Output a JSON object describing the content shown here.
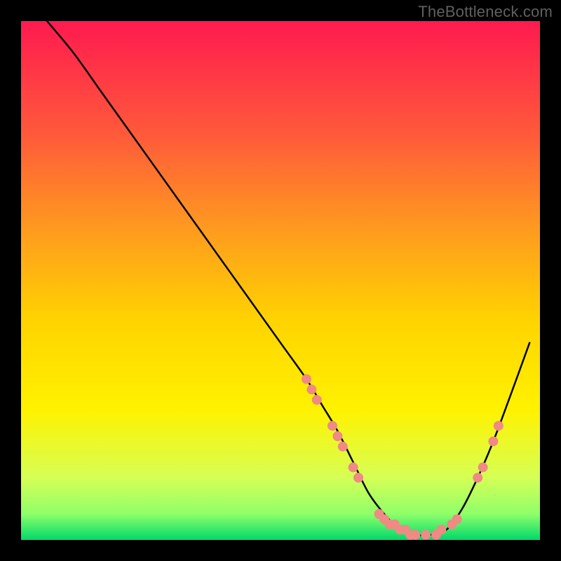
{
  "watermark": "TheBottleneck.com",
  "chart_data": {
    "type": "line",
    "title": "",
    "xlabel": "",
    "ylabel": "",
    "xlim": [
      0,
      100
    ],
    "ylim": [
      0,
      100
    ],
    "grid": false,
    "legend": false,
    "background_gradient": {
      "top": "#ff1a4f",
      "upper_mid": "#ff8a1f",
      "mid": "#ffe500",
      "lower": "#d6ff55",
      "bottom": "#00d96b"
    },
    "series": [
      {
        "name": "bottleneck-curve",
        "color": "#000000",
        "x": [
          5,
          10,
          15,
          20,
          25,
          30,
          35,
          40,
          45,
          50,
          55,
          58,
          61,
          64,
          67,
          70,
          73,
          76,
          79,
          82,
          85,
          88,
          91,
          94,
          98
        ],
        "y": [
          100,
          94,
          87,
          80,
          73,
          66,
          59,
          52,
          45,
          38,
          31,
          26,
          21,
          15,
          9,
          5,
          2,
          1,
          1,
          2,
          6,
          12,
          19,
          27,
          38
        ]
      }
    ],
    "markers": [
      {
        "name": "marker-cluster-left",
        "color": "#ef8a84",
        "points": [
          {
            "x": 55,
            "y": 31
          },
          {
            "x": 56,
            "y": 29
          },
          {
            "x": 57,
            "y": 27
          },
          {
            "x": 60,
            "y": 22
          },
          {
            "x": 61,
            "y": 20
          },
          {
            "x": 62,
            "y": 18
          },
          {
            "x": 64,
            "y": 14
          },
          {
            "x": 65,
            "y": 12
          }
        ]
      },
      {
        "name": "marker-cluster-bottom",
        "color": "#ef8a84",
        "points": [
          {
            "x": 69,
            "y": 5
          },
          {
            "x": 70,
            "y": 4
          },
          {
            "x": 71,
            "y": 3
          },
          {
            "x": 72,
            "y": 3
          },
          {
            "x": 73,
            "y": 2
          },
          {
            "x": 74,
            "y": 2
          },
          {
            "x": 75,
            "y": 1
          },
          {
            "x": 76,
            "y": 1
          },
          {
            "x": 78,
            "y": 1
          },
          {
            "x": 80,
            "y": 1
          },
          {
            "x": 81,
            "y": 2
          },
          {
            "x": 83,
            "y": 3
          },
          {
            "x": 84,
            "y": 4
          }
        ]
      },
      {
        "name": "marker-cluster-right",
        "color": "#ef8a84",
        "points": [
          {
            "x": 88,
            "y": 12
          },
          {
            "x": 89,
            "y": 14
          },
          {
            "x": 91,
            "y": 19
          },
          {
            "x": 92,
            "y": 22
          }
        ]
      }
    ]
  }
}
